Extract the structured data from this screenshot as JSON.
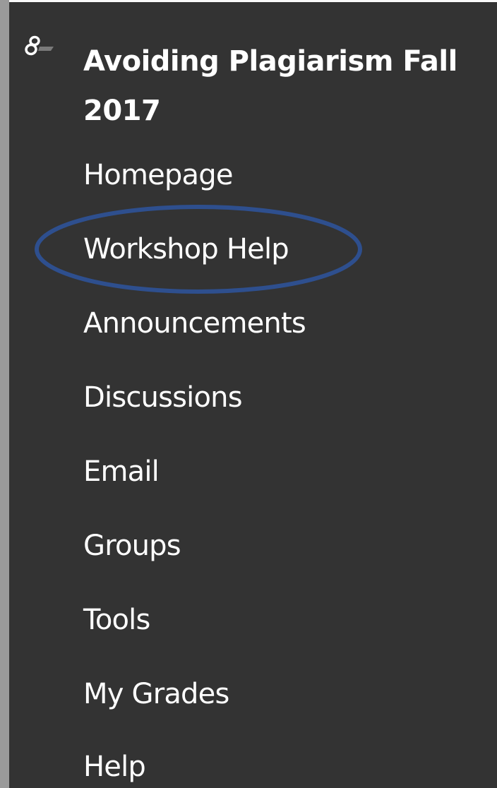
{
  "colors": {
    "background": "#333333",
    "left_bar": "#9a9a9a",
    "text": "#ffffff",
    "highlight_circle": "#2e4f8e"
  },
  "course": {
    "icon": "course-menu-icon",
    "title": "Avoiding Plagiarism Fall 2017"
  },
  "nav": {
    "items": [
      {
        "label": "Homepage"
      },
      {
        "label": "Workshop Help",
        "highlighted": true
      },
      {
        "label": "Announcements"
      },
      {
        "label": "Discussions"
      },
      {
        "label": "Email"
      },
      {
        "label": "Groups"
      },
      {
        "label": "Tools"
      },
      {
        "label": "My Grades"
      },
      {
        "label": "Help"
      }
    ]
  }
}
